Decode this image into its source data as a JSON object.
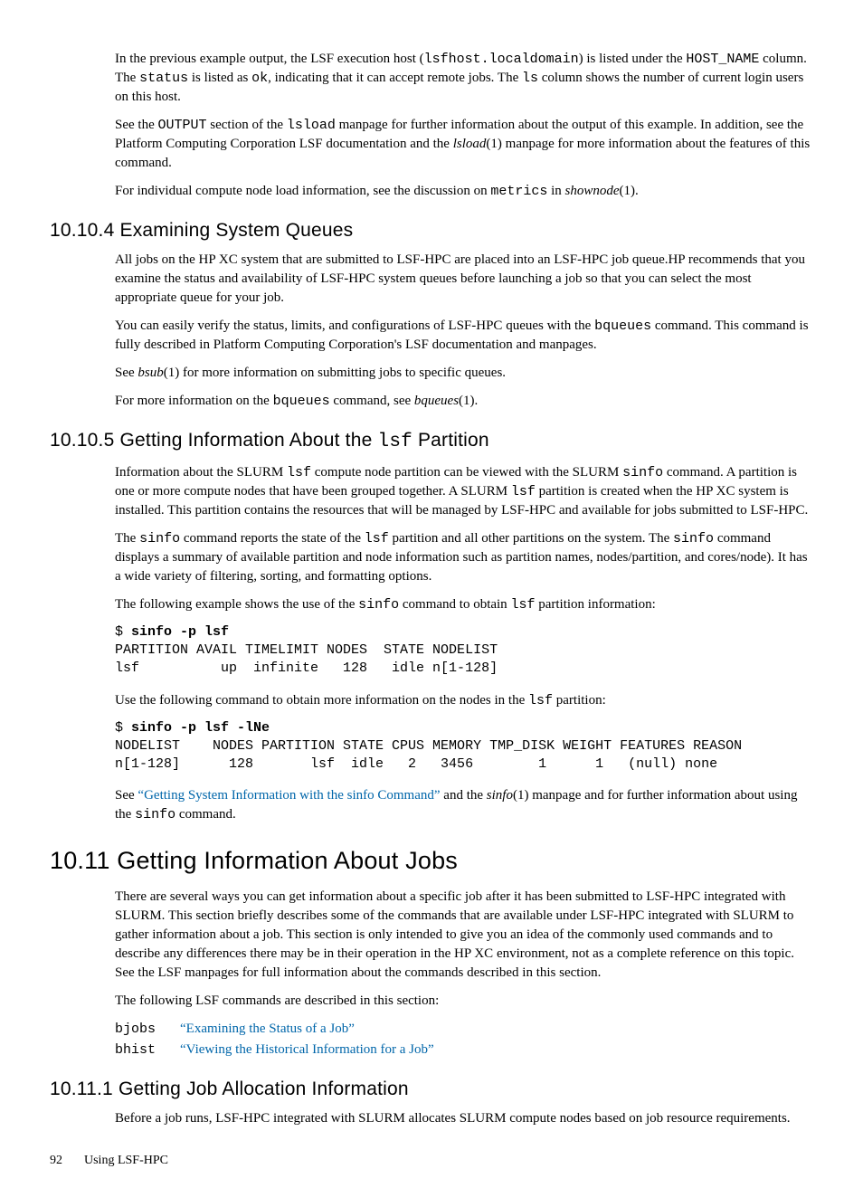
{
  "p1_a": "In the previous example output, the LSF execution host (",
  "p1_b": "lsfhost.localdomain",
  "p1_c": ") is listed under the ",
  "p1_d": "HOST_NAME",
  "p1_e": " column. The ",
  "p1_f": "status",
  "p1_g": " is listed as ",
  "p1_h": "ok",
  "p1_i": ", indicating that it can accept remote jobs. The ",
  "p1_j": "ls",
  "p1_k": " column shows the number of current login users on this host.",
  "p2_a": "See the ",
  "p2_b": "OUTPUT",
  "p2_c": " section of the ",
  "p2_d": "lsload",
  "p2_e": " manpage for further information about the output of this example. In addition, see the Platform Computing Corporation LSF documentation and the ",
  "p2_f": "lsload",
  "p2_g": "(1) manpage for more information about the features of this command.",
  "p3_a": "For individual compute node load information, see the discussion on ",
  "p3_b": "metrics",
  "p3_c": " in ",
  "p3_d": "shownode",
  "p3_e": "(1).",
  "h1": "10.10.4 Examining System Queues",
  "p4": "All jobs on the HP XC system that are submitted to LSF-HPC are placed into an LSF-HPC job queue.HP recommends that you examine the status and availability of LSF-HPC system queues before launching a job so that you can select the most appropriate queue for your job.",
  "p5_a": "You can easily verify the status, limits, and configurations of LSF-HPC queues with the ",
  "p5_b": "bqueues",
  "p5_c": " command. This command is fully described in Platform Computing Corporation's LSF documentation and manpages.",
  "p6_a": "See ",
  "p6_b": "bsub",
  "p6_c": "(1) for more information on submitting jobs to specific queues.",
  "p7_a": "For more information on the ",
  "p7_b": "bqueues",
  "p7_c": " command, see ",
  "p7_d": "bqueues",
  "p7_e": "(1).",
  "h2_a": "10.10.5 Getting Information About the ",
  "h2_b": "lsf",
  "h2_c": " Partition",
  "p8_a": "Information about the SLURM ",
  "p8_b": "lsf",
  "p8_c": " compute node partition can be viewed with the SLURM ",
  "p8_d": "sinfo",
  "p8_e": " command. A partition is one or more compute nodes that have been grouped together. A SLURM ",
  "p8_f": "lsf",
  "p8_g": " partition is created when the HP XC system is installed. This partition contains the resources that will be managed by LSF-HPC and available for jobs submitted to LSF-HPC.",
  "p9_a": "The ",
  "p9_b": "sinfo",
  "p9_c": " command reports the state of the ",
  "p9_d": "lsf",
  "p9_e": " partition and all other partitions on the system. The ",
  "p9_f": "sinfo",
  "p9_g": " command displays a summary of available partition and node information such as partition names, nodes/partition, and cores/node). It has a wide variety of filtering, sorting, and formatting options.",
  "p10_a": "The following example shows the use of the ",
  "p10_b": "sinfo",
  "p10_c": " command to obtain ",
  "p10_d": "lsf",
  "p10_e": " partition information:",
  "code1_prompt": "$ ",
  "code1_cmd": "sinfo -p lsf",
  "code1_out": "PARTITION AVAIL TIMELIMIT NODES  STATE NODELIST\nlsf          up  infinite   128   idle n[1-128]",
  "p11_a": "Use the following command to obtain more information on the nodes in the ",
  "p11_b": "lsf",
  "p11_c": " partition:",
  "code2_prompt": "$ ",
  "code2_cmd": "sinfo -p lsf -lNe",
  "code2_out": "NODELIST    NODES PARTITION STATE CPUS MEMORY TMP_DISK WEIGHT FEATURES REASON\nn[1-128]      128       lsf  idle   2   3456        1      1   (null) none",
  "p12_a": "See ",
  "p12_b": "“Getting System Information with the sinfo Command”",
  "p12_c": " and the ",
  "p12_d": "sinfo",
  "p12_e": "(1) manpage and for further information about using the ",
  "p12_f": "sinfo",
  "p12_g": " command.",
  "h3": "10.11 Getting Information About Jobs",
  "p13": "There are several ways you can get information about a specific job after it has been submitted to LSF-HPC integrated with SLURM. This section briefly describes some of the commands that are available under LSF-HPC integrated with SLURM to gather information about a job. This section is only intended to give you an idea of the commonly used commands and to describe any differences there may be in their operation in the HP XC environment, not as a complete reference on this topic. See the LSF manpages for full information about the commands described in this section.",
  "p14": "The following LSF commands are described in this section:",
  "cmds": [
    {
      "name": "bjobs",
      "link": "“Examining the Status of a Job”"
    },
    {
      "name": "bhist",
      "link": "“Viewing the Historical Information for a Job”"
    }
  ],
  "h4": "10.11.1 Getting Job Allocation Information",
  "p15": "Before a job runs, LSF-HPC integrated with SLURM allocates SLURM compute nodes based on job resource requirements.",
  "footer_page": "92",
  "footer_title": "Using LSF-HPC"
}
